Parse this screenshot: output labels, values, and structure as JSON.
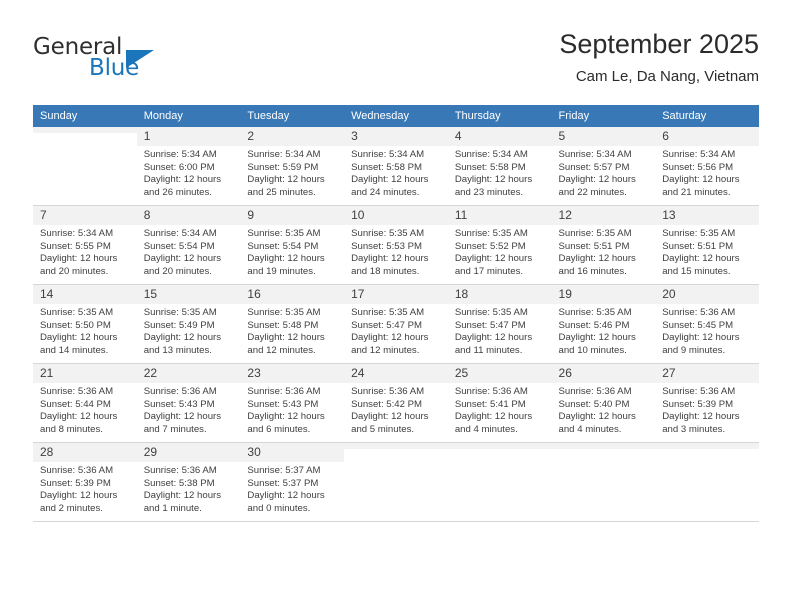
{
  "brand": {
    "name_top": "General",
    "name_bottom": "Blue",
    "accent_color": "#1b75bb"
  },
  "header": {
    "title": "September 2025",
    "subtitle": "Cam Le, Da Nang, Vietnam"
  },
  "theme": {
    "header_row_bg": "#3878b6",
    "daynum_bg": "#f2f2f2",
    "grid_line": "#d6d6d6",
    "text": "#3f3f3f"
  },
  "weekday_headers": [
    "Sunday",
    "Monday",
    "Tuesday",
    "Wednesday",
    "Thursday",
    "Friday",
    "Saturday"
  ],
  "labels": {
    "sunrise_prefix": "Sunrise:",
    "sunset_prefix": "Sunset:",
    "daylight_prefix": "Daylight:"
  },
  "weeks": [
    [
      {
        "day": "",
        "empty": true,
        "sunrise": "",
        "sunset": "",
        "daylight_line1": "",
        "daylight_line2": ""
      },
      {
        "day": "1",
        "sunrise": "Sunrise: 5:34 AM",
        "sunset": "Sunset: 6:00 PM",
        "daylight_line1": "Daylight: 12 hours",
        "daylight_line2": "and 26 minutes."
      },
      {
        "day": "2",
        "sunrise": "Sunrise: 5:34 AM",
        "sunset": "Sunset: 5:59 PM",
        "daylight_line1": "Daylight: 12 hours",
        "daylight_line2": "and 25 minutes."
      },
      {
        "day": "3",
        "sunrise": "Sunrise: 5:34 AM",
        "sunset": "Sunset: 5:58 PM",
        "daylight_line1": "Daylight: 12 hours",
        "daylight_line2": "and 24 minutes."
      },
      {
        "day": "4",
        "sunrise": "Sunrise: 5:34 AM",
        "sunset": "Sunset: 5:58 PM",
        "daylight_line1": "Daylight: 12 hours",
        "daylight_line2": "and 23 minutes."
      },
      {
        "day": "5",
        "sunrise": "Sunrise: 5:34 AM",
        "sunset": "Sunset: 5:57 PM",
        "daylight_line1": "Daylight: 12 hours",
        "daylight_line2": "and 22 minutes."
      },
      {
        "day": "6",
        "sunrise": "Sunrise: 5:34 AM",
        "sunset": "Sunset: 5:56 PM",
        "daylight_line1": "Daylight: 12 hours",
        "daylight_line2": "and 21 minutes."
      }
    ],
    [
      {
        "day": "7",
        "sunrise": "Sunrise: 5:34 AM",
        "sunset": "Sunset: 5:55 PM",
        "daylight_line1": "Daylight: 12 hours",
        "daylight_line2": "and 20 minutes."
      },
      {
        "day": "8",
        "sunrise": "Sunrise: 5:34 AM",
        "sunset": "Sunset: 5:54 PM",
        "daylight_line1": "Daylight: 12 hours",
        "daylight_line2": "and 20 minutes."
      },
      {
        "day": "9",
        "sunrise": "Sunrise: 5:35 AM",
        "sunset": "Sunset: 5:54 PM",
        "daylight_line1": "Daylight: 12 hours",
        "daylight_line2": "and 19 minutes."
      },
      {
        "day": "10",
        "sunrise": "Sunrise: 5:35 AM",
        "sunset": "Sunset: 5:53 PM",
        "daylight_line1": "Daylight: 12 hours",
        "daylight_line2": "and 18 minutes."
      },
      {
        "day": "11",
        "sunrise": "Sunrise: 5:35 AM",
        "sunset": "Sunset: 5:52 PM",
        "daylight_line1": "Daylight: 12 hours",
        "daylight_line2": "and 17 minutes."
      },
      {
        "day": "12",
        "sunrise": "Sunrise: 5:35 AM",
        "sunset": "Sunset: 5:51 PM",
        "daylight_line1": "Daylight: 12 hours",
        "daylight_line2": "and 16 minutes."
      },
      {
        "day": "13",
        "sunrise": "Sunrise: 5:35 AM",
        "sunset": "Sunset: 5:51 PM",
        "daylight_line1": "Daylight: 12 hours",
        "daylight_line2": "and 15 minutes."
      }
    ],
    [
      {
        "day": "14",
        "sunrise": "Sunrise: 5:35 AM",
        "sunset": "Sunset: 5:50 PM",
        "daylight_line1": "Daylight: 12 hours",
        "daylight_line2": "and 14 minutes."
      },
      {
        "day": "15",
        "sunrise": "Sunrise: 5:35 AM",
        "sunset": "Sunset: 5:49 PM",
        "daylight_line1": "Daylight: 12 hours",
        "daylight_line2": "and 13 minutes."
      },
      {
        "day": "16",
        "sunrise": "Sunrise: 5:35 AM",
        "sunset": "Sunset: 5:48 PM",
        "daylight_line1": "Daylight: 12 hours",
        "daylight_line2": "and 12 minutes."
      },
      {
        "day": "17",
        "sunrise": "Sunrise: 5:35 AM",
        "sunset": "Sunset: 5:47 PM",
        "daylight_line1": "Daylight: 12 hours",
        "daylight_line2": "and 12 minutes."
      },
      {
        "day": "18",
        "sunrise": "Sunrise: 5:35 AM",
        "sunset": "Sunset: 5:47 PM",
        "daylight_line1": "Daylight: 12 hours",
        "daylight_line2": "and 11 minutes."
      },
      {
        "day": "19",
        "sunrise": "Sunrise: 5:35 AM",
        "sunset": "Sunset: 5:46 PM",
        "daylight_line1": "Daylight: 12 hours",
        "daylight_line2": "and 10 minutes."
      },
      {
        "day": "20",
        "sunrise": "Sunrise: 5:36 AM",
        "sunset": "Sunset: 5:45 PM",
        "daylight_line1": "Daylight: 12 hours",
        "daylight_line2": "and 9 minutes."
      }
    ],
    [
      {
        "day": "21",
        "sunrise": "Sunrise: 5:36 AM",
        "sunset": "Sunset: 5:44 PM",
        "daylight_line1": "Daylight: 12 hours",
        "daylight_line2": "and 8 minutes."
      },
      {
        "day": "22",
        "sunrise": "Sunrise: 5:36 AM",
        "sunset": "Sunset: 5:43 PM",
        "daylight_line1": "Daylight: 12 hours",
        "daylight_line2": "and 7 minutes."
      },
      {
        "day": "23",
        "sunrise": "Sunrise: 5:36 AM",
        "sunset": "Sunset: 5:43 PM",
        "daylight_line1": "Daylight: 12 hours",
        "daylight_line2": "and 6 minutes."
      },
      {
        "day": "24",
        "sunrise": "Sunrise: 5:36 AM",
        "sunset": "Sunset: 5:42 PM",
        "daylight_line1": "Daylight: 12 hours",
        "daylight_line2": "and 5 minutes."
      },
      {
        "day": "25",
        "sunrise": "Sunrise: 5:36 AM",
        "sunset": "Sunset: 5:41 PM",
        "daylight_line1": "Daylight: 12 hours",
        "daylight_line2": "and 4 minutes."
      },
      {
        "day": "26",
        "sunrise": "Sunrise: 5:36 AM",
        "sunset": "Sunset: 5:40 PM",
        "daylight_line1": "Daylight: 12 hours",
        "daylight_line2": "and 4 minutes."
      },
      {
        "day": "27",
        "sunrise": "Sunrise: 5:36 AM",
        "sunset": "Sunset: 5:39 PM",
        "daylight_line1": "Daylight: 12 hours",
        "daylight_line2": "and 3 minutes."
      }
    ],
    [
      {
        "day": "28",
        "sunrise": "Sunrise: 5:36 AM",
        "sunset": "Sunset: 5:39 PM",
        "daylight_line1": "Daylight: 12 hours",
        "daylight_line2": "and 2 minutes."
      },
      {
        "day": "29",
        "sunrise": "Sunrise: 5:36 AM",
        "sunset": "Sunset: 5:38 PM",
        "daylight_line1": "Daylight: 12 hours",
        "daylight_line2": "and 1 minute."
      },
      {
        "day": "30",
        "sunrise": "Sunrise: 5:37 AM",
        "sunset": "Sunset: 5:37 PM",
        "daylight_line1": "Daylight: 12 hours",
        "daylight_line2": "and 0 minutes."
      },
      {
        "day": "",
        "empty": true,
        "sunrise": "",
        "sunset": "",
        "daylight_line1": "",
        "daylight_line2": ""
      },
      {
        "day": "",
        "empty": true,
        "sunrise": "",
        "sunset": "",
        "daylight_line1": "",
        "daylight_line2": ""
      },
      {
        "day": "",
        "empty": true,
        "sunrise": "",
        "sunset": "",
        "daylight_line1": "",
        "daylight_line2": ""
      },
      {
        "day": "",
        "empty": true,
        "sunrise": "",
        "sunset": "",
        "daylight_line1": "",
        "daylight_line2": ""
      }
    ]
  ]
}
